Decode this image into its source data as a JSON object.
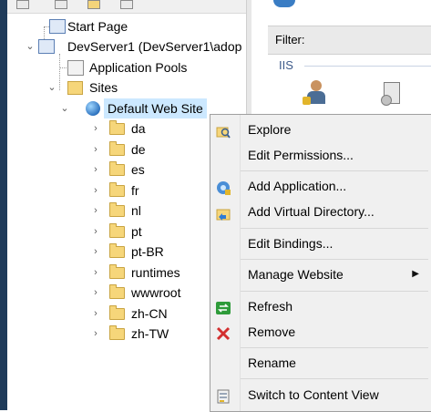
{
  "tree": {
    "start_page": "Start Page",
    "server": "DevServer1 (DevServer1\\adop",
    "app_pools": "Application Pools",
    "sites": "Sites",
    "default_site": "Default Web Site",
    "folders": [
      "da",
      "de",
      "es",
      "fr",
      "nl",
      "pt",
      "pt-BR",
      "runtimes",
      "wwwroot",
      "zh-CN",
      "zh-TW"
    ]
  },
  "right_pane": {
    "filter_label": "Filter:",
    "section_label": "IIS"
  },
  "context_menu": {
    "items": [
      {
        "label": "Explore",
        "icon": "explore-icon"
      },
      {
        "label": "Edit Permissions...",
        "icon": ""
      },
      {
        "label": "Add Application...",
        "icon": "add-application-icon"
      },
      {
        "label": "Add Virtual Directory...",
        "icon": "add-virtual-directory-icon"
      },
      {
        "label": "Edit Bindings...",
        "icon": ""
      },
      {
        "label": "Manage Website",
        "icon": "",
        "submenu": true
      },
      {
        "label": "Refresh",
        "icon": "refresh-icon"
      },
      {
        "label": "Remove",
        "icon": "remove-icon"
      },
      {
        "label": "Rename",
        "icon": ""
      },
      {
        "label": "Switch to Content View",
        "icon": "content-view-icon"
      }
    ]
  },
  "colors": {
    "selection": "#cce8ff",
    "menu_bg": "#f0f0f0",
    "remove_red": "#d32f2f",
    "refresh_green": "#2e9b3a"
  }
}
